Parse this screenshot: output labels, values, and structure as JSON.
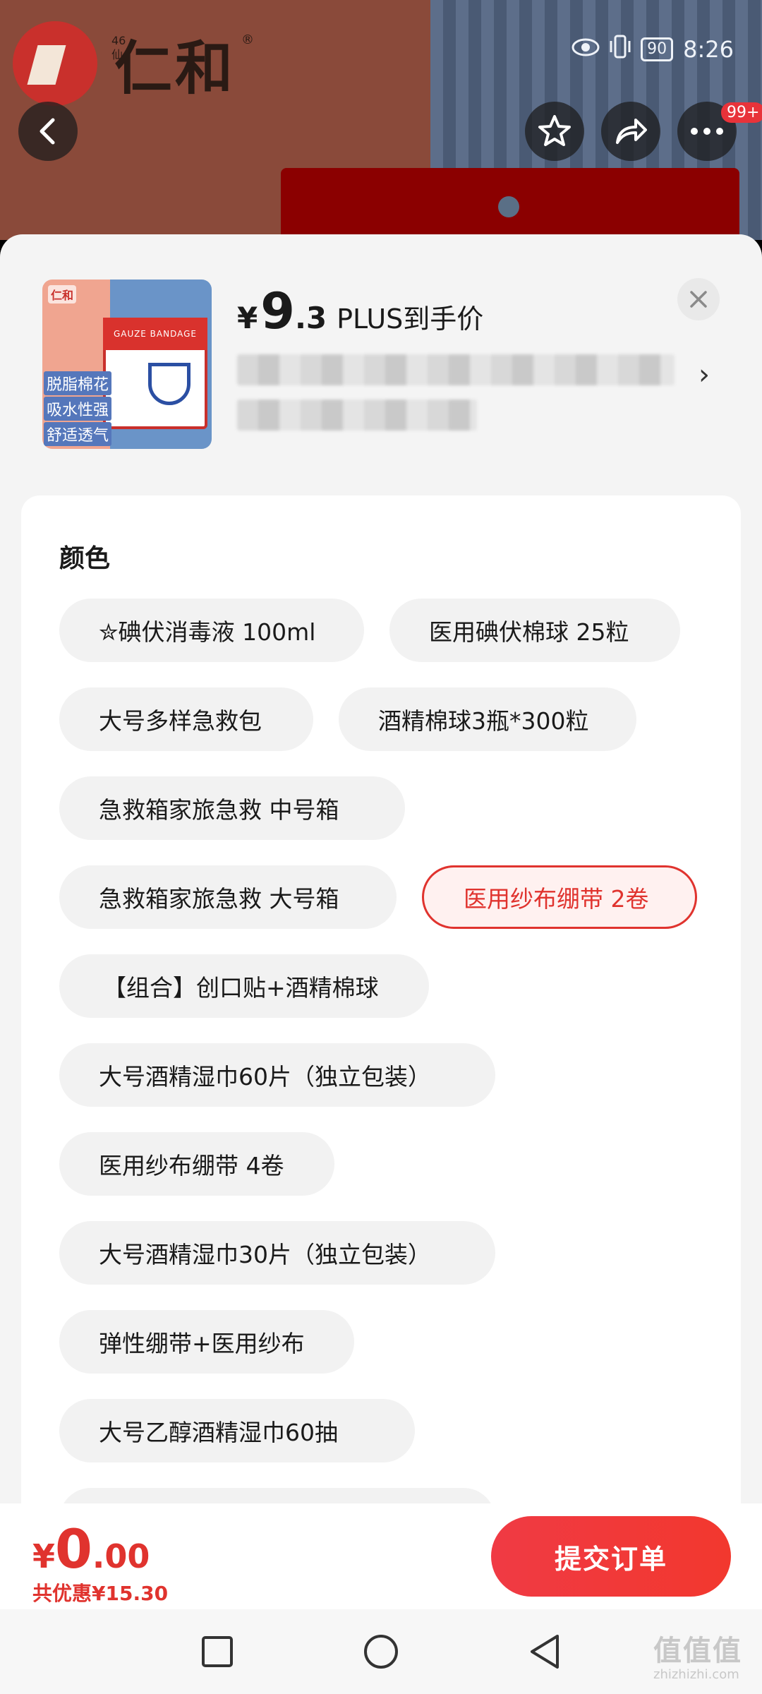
{
  "background": {
    "brand_name": "仁和",
    "brand_reg": "®",
    "brand_sub": "46仙",
    "colors": {
      "left": "#8a4a3a",
      "right": "#5d6e8a",
      "redbox": "#8b0000"
    }
  },
  "status_bar": {
    "battery": "90",
    "time": "8:26",
    "icons": [
      "eye-icon",
      "vibrate-icon",
      "battery-icon"
    ]
  },
  "top_buttons": {
    "back": "back-icon",
    "favorite": "star-icon",
    "share": "share-icon",
    "more": "more-icon",
    "badge": "99+"
  },
  "product": {
    "thumb": {
      "brand": "仁和",
      "package_title": "GAUZE BANDAGE",
      "labels": [
        "脱脂棉花",
        "吸水性强",
        "舒适透气"
      ]
    },
    "price": {
      "currency": "¥",
      "integer": "9",
      "decimal": ".3",
      "label": "PLUS到手价"
    },
    "close_icon": "close-icon",
    "chevron": "›"
  },
  "options": {
    "title": "颜色",
    "selected_index": 5,
    "items": [
      "✮碘伏消毒液 100ml",
      "医用碘伏棉球 25粒",
      "大号多样急救包",
      "酒精棉球3瓶*300粒",
      "急救箱家旅急救  中号箱",
      "急救箱家旅急救 大号箱",
      "医用纱布绷带 2卷",
      "【组合】创口贴+酒精棉球",
      "大号酒精湿巾60片（独立包装）",
      "医用纱布绷带 4卷",
      "大号酒精湿巾30片（独立包装）",
      "弹性绷带+医用纱布",
      "大号乙醇酒精湿巾60抽",
      ""
    ]
  },
  "bottom_bar": {
    "currency": "¥",
    "integer": "0",
    "decimal": ".00",
    "discount": "共优惠¥15.30",
    "submit": "提交订单",
    "accent": "#e0332e"
  },
  "nav_bar": {
    "buttons": [
      "recent-apps-icon",
      "home-icon",
      "back-triangle-icon"
    ]
  },
  "watermark": {
    "text": "值值值",
    "sub": "zhizhizhi.com"
  }
}
